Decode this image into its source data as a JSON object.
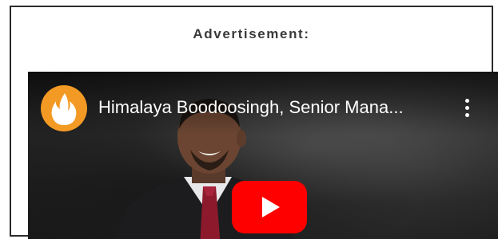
{
  "ad": {
    "label": "Advertisement:"
  },
  "video": {
    "title": "Himalaya Boodoosingh, Senior Mana...",
    "channel_logo_icon": "flame-icon",
    "menu_icon": "more-vert-icon",
    "play_icon": "youtube-play-icon"
  },
  "colors": {
    "play_button": "#ff0000",
    "logo_bg": "#f39a24",
    "frame_border": "#2b2b2b"
  }
}
